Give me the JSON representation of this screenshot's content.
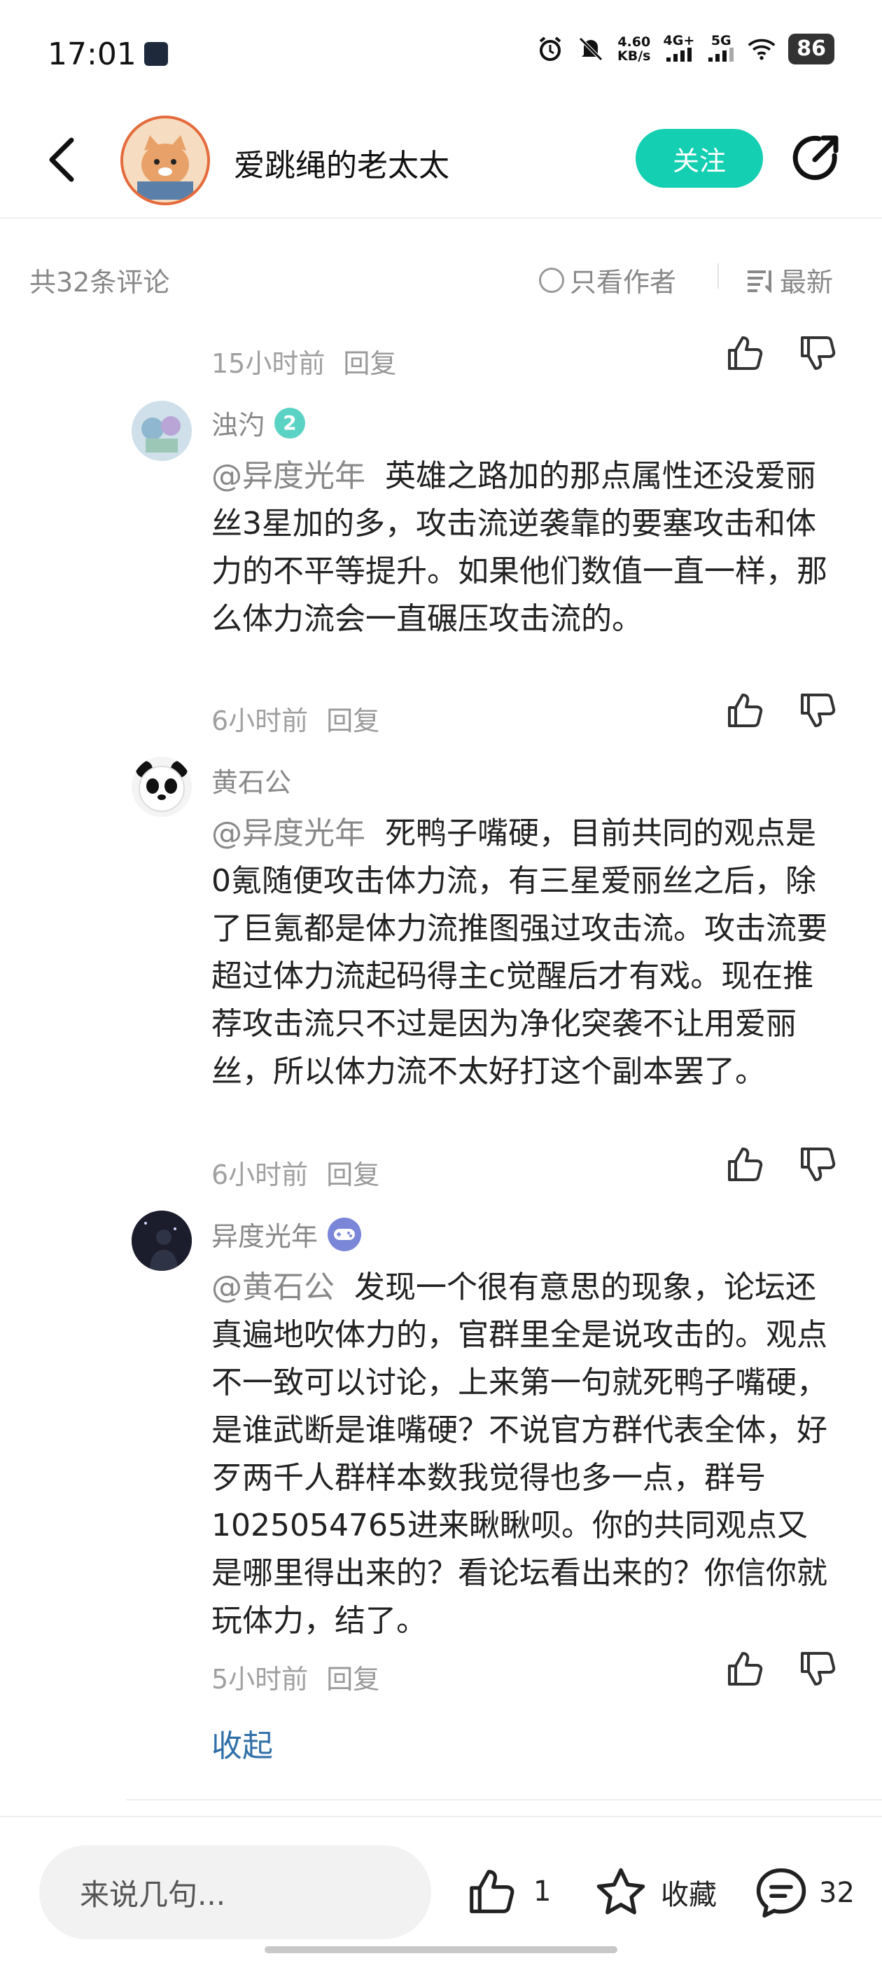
{
  "status_bar": {
    "time": "17:01",
    "net_speed": "4.60",
    "net_unit": "KB/s",
    "sig1": "4G+",
    "sig2": "5G",
    "battery": "86"
  },
  "header": {
    "title": "爱跳绳的老太太",
    "follow_label": "关注"
  },
  "filter": {
    "count": "共32条评论",
    "author_only": "只看作者",
    "sort": "最新"
  },
  "comments": [
    {
      "time": "15小时前",
      "reply": "回复"
    },
    {
      "name": "浊汋",
      "badge": "2",
      "mention": "@异度光年",
      "text": "英雄之路加的那点属性还没爱丽丝3星加的多，攻击流逆袭靠的要塞攻击和体力的不平等提升。如果他们数值一直一样，那么体力流会一直碾压攻击流的。",
      "time": "6小时前",
      "reply": "回复"
    },
    {
      "name": "黄石公",
      "mention": "@异度光年",
      "text": "死鸭子嘴硬，目前共同的观点是0氪随便攻击体力流，有三星爱丽丝之后，除了巨氪都是体力流推图强过攻击流。攻击流要超过体力流起码得主c觉醒后才有戏。现在推荐攻击流只不过是因为净化突袭不让用爱丽丝，所以体力流不太好打这个副本罢了。",
      "time": "6小时前",
      "reply": "回复"
    },
    {
      "name": "异度光年",
      "mention": "@黄石公",
      "text": "发现一个很有意思的现象，论坛还真遍地吹体力的，官群里全是说攻击的。观点不一致可以讨论，上来第一句就死鸭子嘴硬，是谁武断是谁嘴硬？不说官方群代表全体，好歹两千人群样本数我觉得也多一点，群号1025054765进来瞅瞅呗。你的共同观点又是哪里得出来的？看论坛看出来的？你信你就玩体力，结了。",
      "time": "5小时前",
      "reply": "回复"
    }
  ],
  "collapse_label": "收起",
  "bottom_bar": {
    "input_placeholder": "来说几句...",
    "like_count": "1",
    "favorite_label": "收藏",
    "comment_count": "32"
  }
}
